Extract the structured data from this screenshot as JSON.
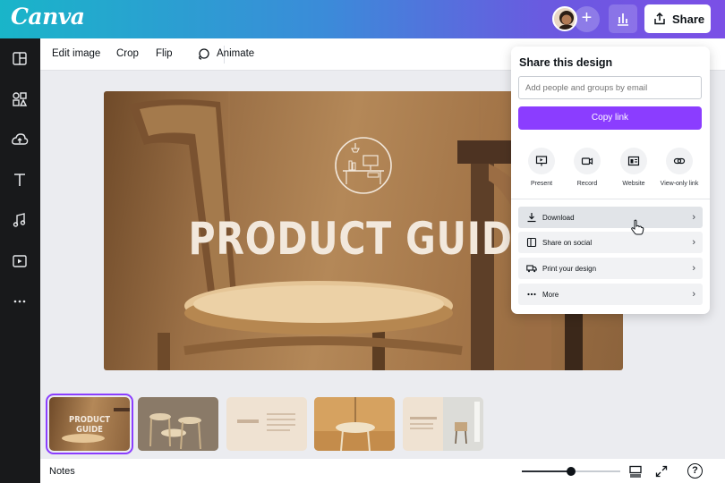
{
  "header": {
    "logo": "Canva",
    "share_label": "Share",
    "add_symbol": "+"
  },
  "rail": {
    "items": [
      "layout-icon",
      "elements-icon",
      "upload-icon",
      "text-icon",
      "music-icon",
      "video-icon",
      "more-icon"
    ]
  },
  "toolbar": {
    "edit_image": "Edit image",
    "crop": "Crop",
    "flip": "Flip",
    "animate": "Animate"
  },
  "canvas": {
    "title": "PRODUCT GUIDE"
  },
  "share_panel": {
    "title": "Share this design",
    "input_placeholder": "Add people and groups by email",
    "copy_link": "Copy link",
    "options": [
      "Present",
      "Record",
      "Website",
      "View-only link"
    ],
    "rows": [
      "Download",
      "Share on social",
      "Print your design",
      "More"
    ]
  },
  "pages": {
    "thumb1_title": "PRODUCT GUIDE"
  },
  "footer": {
    "notes": "Notes",
    "help": "?",
    "zoom_level": 0.5
  },
  "colors": {
    "accent": "#8b3dff",
    "rail": "#18191b"
  }
}
